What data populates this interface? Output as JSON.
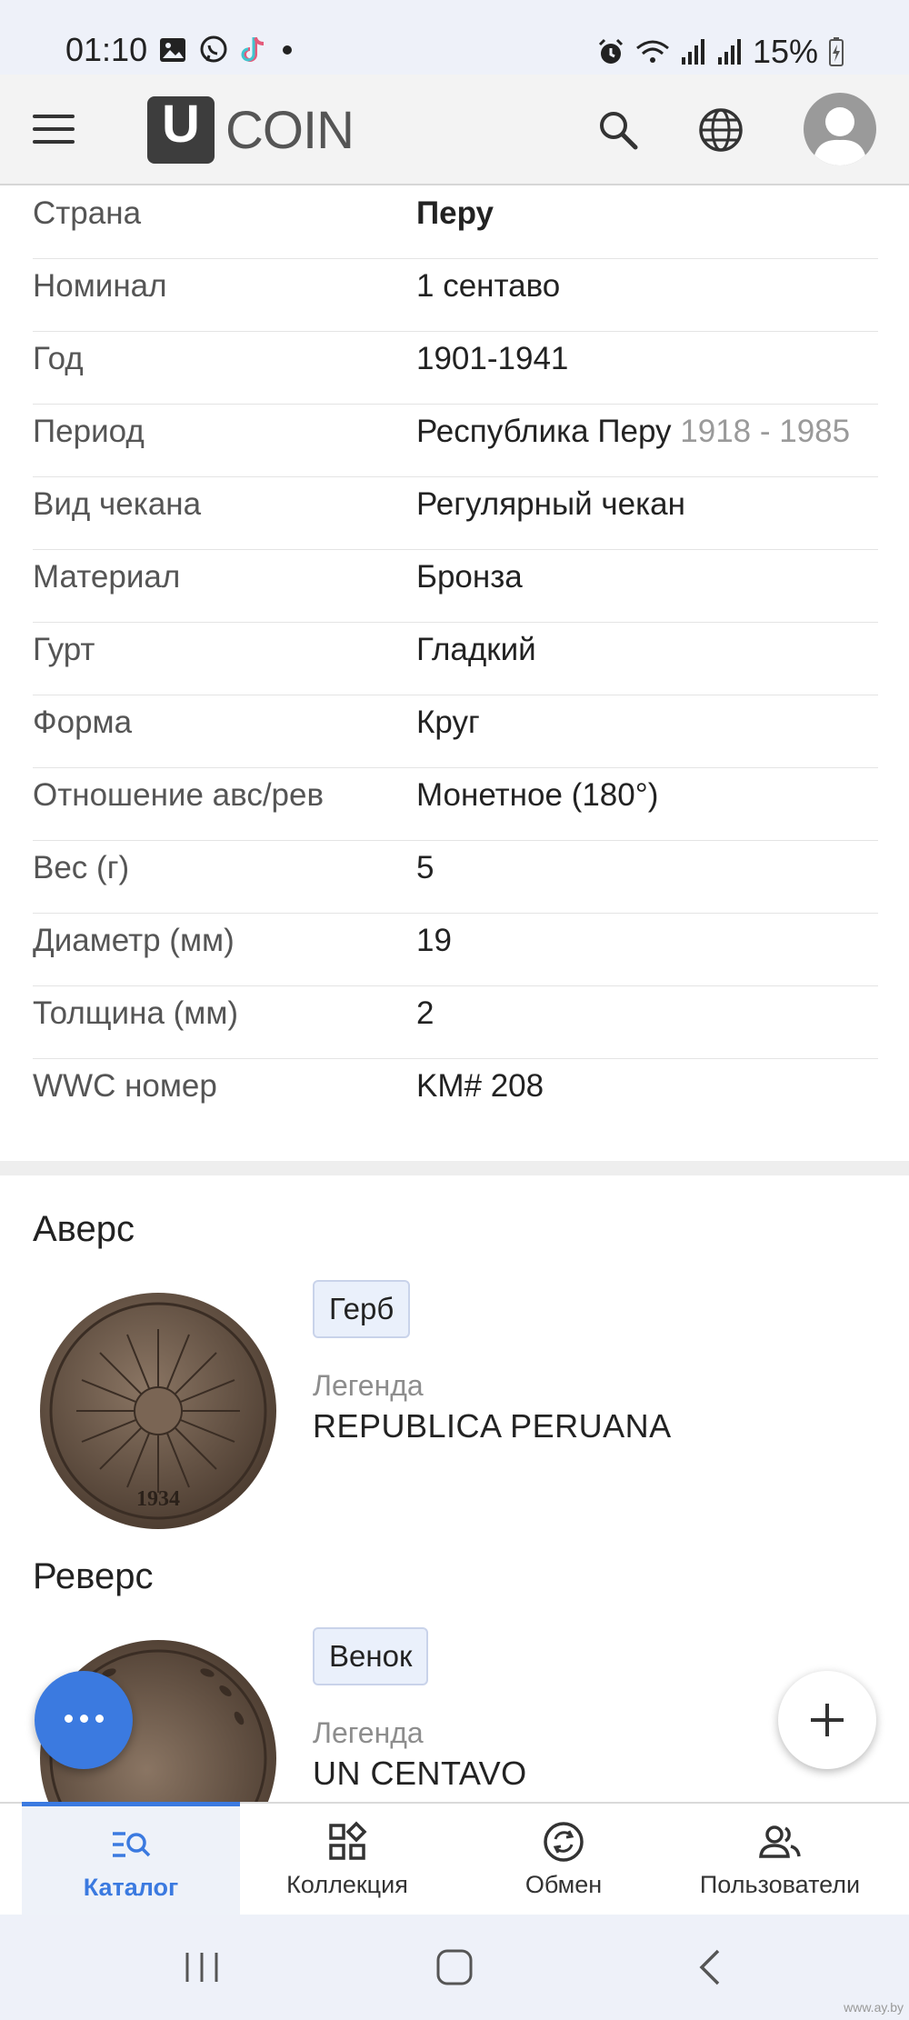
{
  "status_bar": {
    "time": "01:10",
    "battery": "15%",
    "left_icons": [
      "gallery-icon",
      "viber-icon",
      "tiktok-icon",
      "dot-icon"
    ],
    "right_icons": [
      "alarm-icon",
      "wifi-icon",
      "signal-icon",
      "signal-icon",
      "battery-icon"
    ]
  },
  "header": {
    "logo_letter": "U",
    "logo_text": "COIN",
    "icons": [
      "menu-icon",
      "search-icon",
      "globe-icon",
      "avatar-icon"
    ]
  },
  "info_rows": [
    {
      "label": "Страна",
      "value": "Перу"
    },
    {
      "label": "Номинал",
      "value": "1 сентаво"
    },
    {
      "label": "Год",
      "value": "1901-1941"
    },
    {
      "label": "Период",
      "value": "Республика Перу",
      "extra": "1918 - 1985"
    },
    {
      "label": "Вид чекана",
      "value": "Регулярный чекан"
    },
    {
      "label": "Материал",
      "value": "Бронза"
    },
    {
      "label": "Гурт",
      "value": "Гладкий"
    },
    {
      "label": "Форма",
      "value": "Круг"
    },
    {
      "label": "Отношение авс/рев",
      "value": "Монетное (180°)"
    },
    {
      "label": "Вес (г)",
      "value": "5"
    },
    {
      "label": "Диаметр (мм)",
      "value": "19"
    },
    {
      "label": "Толщина (мм)",
      "value": "2"
    },
    {
      "label": "WWC номер",
      "value": "KM# 208"
    }
  ],
  "obverse": {
    "title": "Аверс",
    "tag": "Герб",
    "legend_label": "Легенда",
    "legend": "REPUBLICA PERUANA",
    "coin_text_top": "REPUBLICA PERUANA",
    "coin_year": "1934"
  },
  "reverse": {
    "title": "Реверс",
    "tag": "Венок",
    "legend_label": "Легенда",
    "legend": "UN CENTAVO"
  },
  "bottom_nav": [
    {
      "label": "Каталог",
      "icon": "catalog-search-icon",
      "active": true
    },
    {
      "label": "Коллекция",
      "icon": "collection-icon",
      "active": false
    },
    {
      "label": "Обмен",
      "icon": "exchange-icon",
      "active": false
    },
    {
      "label": "Пользователи",
      "icon": "users-icon",
      "active": false
    }
  ],
  "watermark": "www.ay.by",
  "colors": {
    "accent": "#3b7ae0",
    "tag_bg": "#eaf0fb"
  }
}
